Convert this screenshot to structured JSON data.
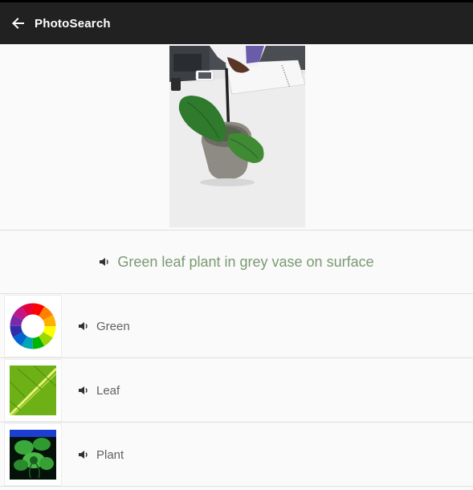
{
  "appbar": {
    "title": "PhotoSearch",
    "back_icon": "arrow-back-icon",
    "background": "#212121"
  },
  "photo": {
    "subject": "green leaf plant in grey vase"
  },
  "caption": {
    "text": "Green leaf plant in grey vase on surface",
    "speaker_icon": "volume-icon",
    "color": "#7a9a72"
  },
  "tags": [
    {
      "label": "Green",
      "thumbnail": "color-wheel-icon"
    },
    {
      "label": "Leaf",
      "thumbnail": "leaf-texture-image"
    },
    {
      "label": "Plant",
      "thumbnail": "plant-image"
    }
  ]
}
